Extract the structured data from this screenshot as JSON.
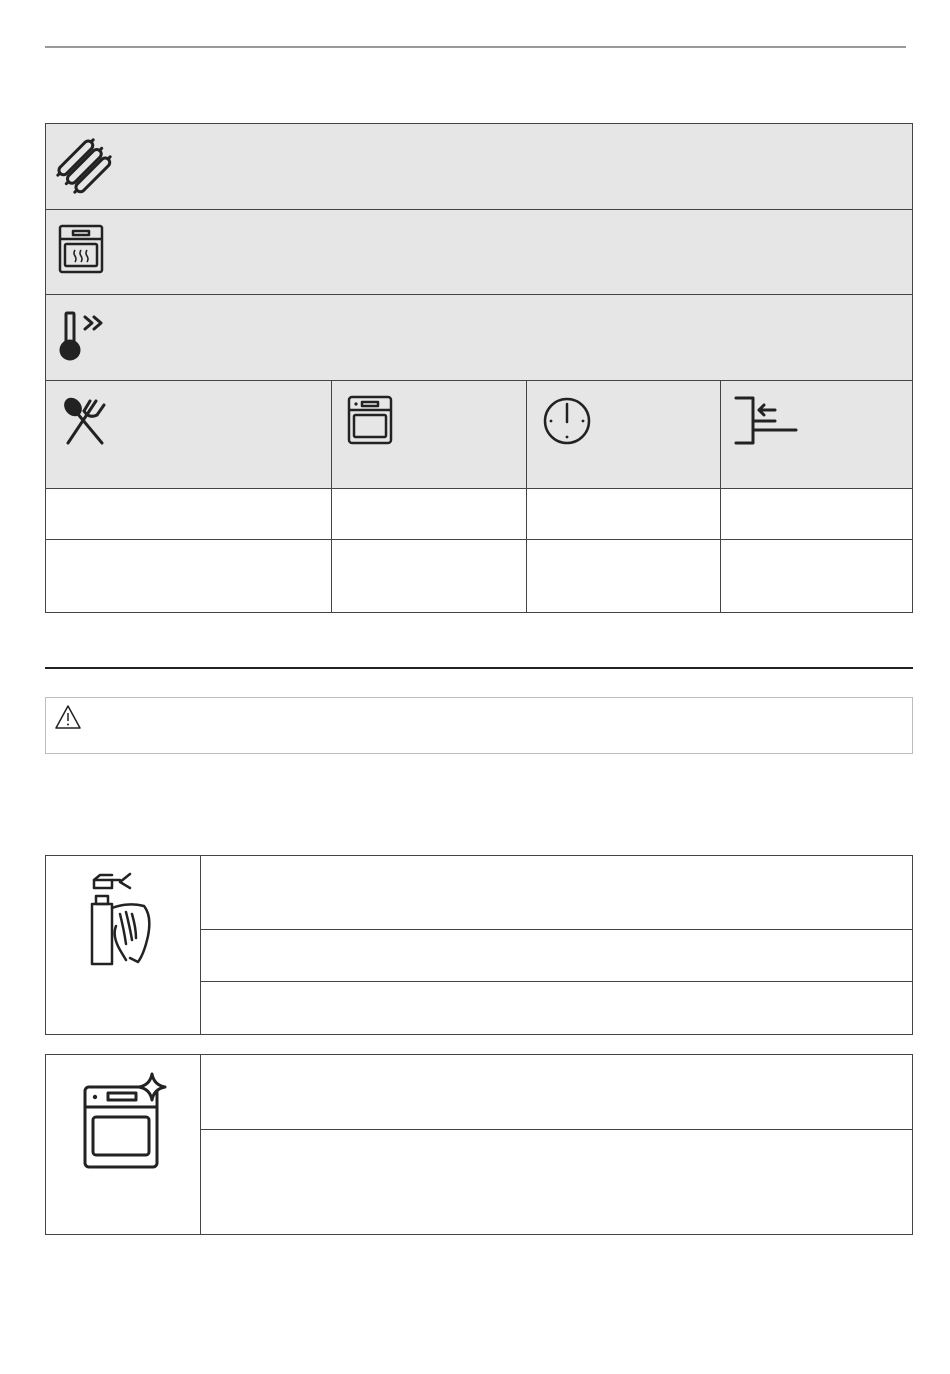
{
  "icons": {
    "row1": "sausages-icon",
    "row2": "steam-oven-icon",
    "row3": "fast-heat-thermometer-icon",
    "col1": "cutlery-icon",
    "col2": "oven-icon",
    "col3": "clock-icon",
    "col4": "shelf-level-icon",
    "warning": "warning-triangle-icon",
    "care1": "spray-cleaning-icon",
    "care2": "clean-oven-sparkle-icon"
  },
  "cooking_table": {
    "rows": [
      [
        "",
        "",
        "",
        ""
      ],
      [
        "",
        "",
        "",
        ""
      ]
    ]
  },
  "warning": {
    "text": ""
  },
  "care_tables": [
    {
      "rows": [
        "",
        "",
        ""
      ]
    },
    {
      "rows": [
        "",
        ""
      ]
    }
  ],
  "colors": {
    "header_fill": "#e6e6e6",
    "border": "#444444",
    "rule_light": "#9a9a9a"
  }
}
